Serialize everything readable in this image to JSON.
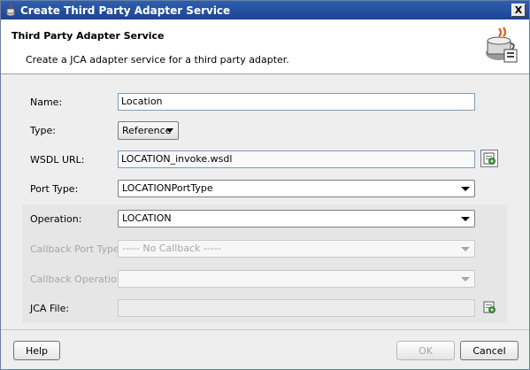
{
  "window": {
    "title": "Create Third Party Adapter Service",
    "close_label": "X"
  },
  "header": {
    "title": "Third Party Adapter Service",
    "description": "Create a JCA adapter service for a third party adapter."
  },
  "form": {
    "name_label": "Name:",
    "name_value": "Location",
    "type_label": "Type:",
    "type_value": "Reference",
    "wsdl_label": "WSDL URL:",
    "wsdl_value": "LOCATION_invoke.wsdl",
    "port_type_label": "Port Type:",
    "port_type_value": "LOCATIONPortType",
    "operation_label": "Operation:",
    "operation_value": "LOCATION",
    "callback_port_type_label": "Callback Port Type:",
    "callback_port_type_value": "----- No Callback -----",
    "callback_operation_label": "Callback Operation:",
    "callback_operation_value": "",
    "jca_file_label": "JCA File:",
    "jca_file_value": ""
  },
  "footer": {
    "help_label": "Help",
    "ok_label": "OK",
    "cancel_label": "Cancel"
  },
  "icons": {
    "app": "coffee-cup-icon",
    "header": "adapter-wizard-icon",
    "browse": "browse-wsdl-icon",
    "jca_browse": "browse-jca-icon"
  },
  "colors": {
    "title_bar": "#1c4390",
    "disabled_text": "#a6a6a6"
  }
}
